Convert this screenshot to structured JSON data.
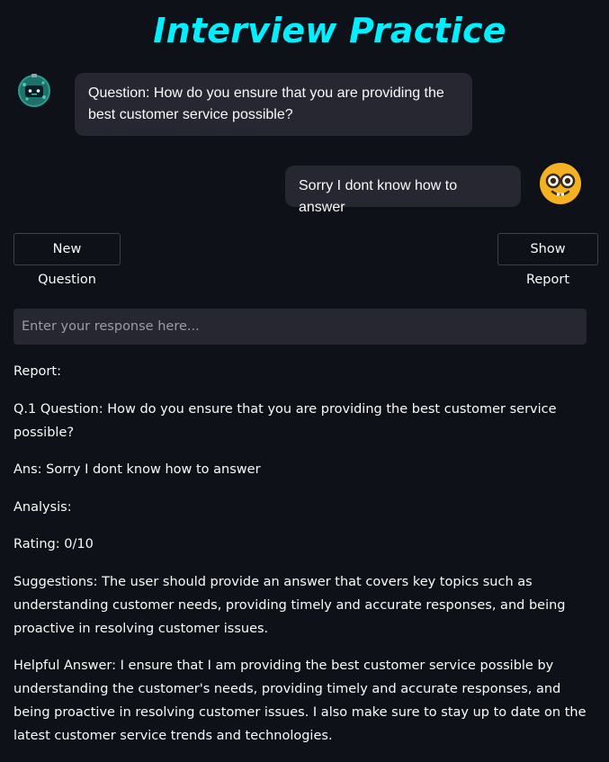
{
  "app": {
    "title": "Interview Practice"
  },
  "chat": {
    "bot_message": "Question: How do you ensure that you are providing the best customer service possible?",
    "user_message": "Sorry I dont know how to answer",
    "bot_avatar_icon": "robot-icon",
    "user_avatar_icon": "nerd-face-icon"
  },
  "buttons": {
    "new_question": "New Question",
    "show_report": "Show Report"
  },
  "input": {
    "placeholder": "Enter your response here...",
    "value": ""
  },
  "report": {
    "heading": "Report:",
    "question": "Q.1 Question: How do you ensure that you are providing the best customer service possible?",
    "answer": "Ans: Sorry I dont know how to answer",
    "analysis": "Analysis:",
    "rating": "Rating: 0/10",
    "suggestions": "Suggestions: The user should provide an answer that covers key topics such as understanding customer needs, providing timely and accurate responses, and being proactive in resolving customer issues.",
    "helpful_answer": "Helpful Answer: I ensure that I am providing the best customer service possible by understanding the customer's needs, providing timely and accurate responses, and being proactive in resolving customer issues. I also make sure to stay up to date on the latest customer service trends and technologies."
  },
  "colors": {
    "background": "#0e1117",
    "title": "#00f0ff",
    "bubble": "#262730",
    "text": "#fafafa",
    "bot_avatar": "#2a9d8f",
    "user_avatar": "#f4b223"
  }
}
